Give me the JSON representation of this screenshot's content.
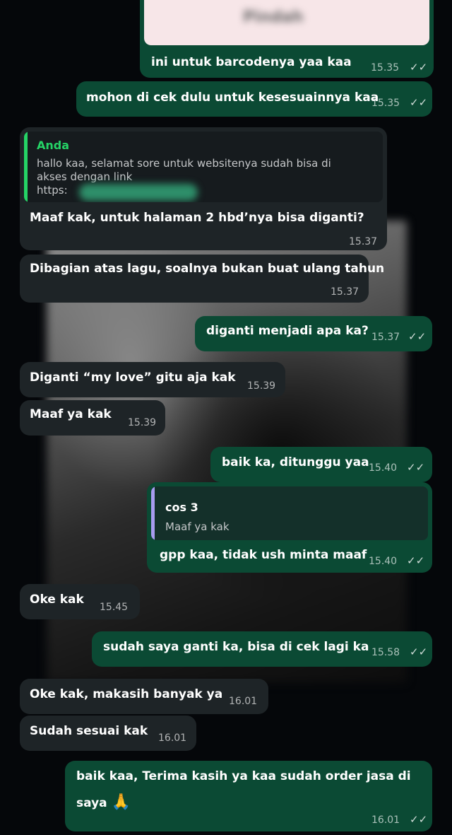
{
  "messages": {
    "m0": {
      "text": "Pindah",
      "time": ""
    },
    "m1": {
      "text": "ini untuk barcodenya yaa kaa",
      "time": "15.35"
    },
    "m2": {
      "text": "mohon di cek dulu untuk kesesuainnya kaa",
      "time": "15.35"
    },
    "m3": {
      "quote_author": "Anda",
      "quote_line1": "hallo kaa, selamat sore untuk websitenya sudah bisa di",
      "quote_line2": "akses dengan link",
      "quote_line3": "https:",
      "text": "Maaf kak, untuk halaman 2 hbd’nya bisa diganti?",
      "time": "15.37"
    },
    "m4": {
      "text": "Dibagian atas lagu, soalnya bukan buat ulang tahun",
      "time": "15.37"
    },
    "m5": {
      "text": "diganti menjadi apa ka?",
      "time": "15.37"
    },
    "m6": {
      "text": "Diganti “my love” gitu aja kak",
      "time": "15.39"
    },
    "m7": {
      "text": "Maaf ya kak",
      "time": "15.39"
    },
    "m8": {
      "text": "baik ka, ditunggu yaa",
      "time": "15.40"
    },
    "m9": {
      "quote_author": "cos 3",
      "quote_text": "Maaf ya kak",
      "text": "gpp kaa, tidak ush minta maaf",
      "time": "15.40"
    },
    "m10": {
      "text": "Oke kak",
      "time": "15.45"
    },
    "m11": {
      "text": "sudah saya ganti ka, bisa di cek lagi ka",
      "time": "15.58"
    },
    "m12": {
      "text": "Oke kak, makasih banyak ya",
      "time": "16.01"
    },
    "m13": {
      "text": "Sudah sesuai kak",
      "time": "16.01"
    },
    "m14": {
      "text_line1": "baik kaa, Terima kasih ya kaa sudah order jasa di",
      "text_line2": "saya",
      "time": "16.01"
    }
  },
  "icons": {
    "read_receipt": "double-check-icon",
    "emoji": "folded-hands-emoji"
  },
  "colors": {
    "outgoing_bubble": "#0b4a34",
    "incoming_bubble": "#1e2427",
    "quote_bar_green": "#25d366",
    "quote_bar_purple": "#a89bf0",
    "background": "#05070a"
  }
}
